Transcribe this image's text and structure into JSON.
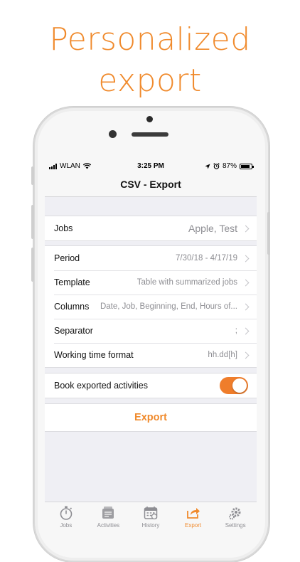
{
  "headline": {
    "line1": "Personalized",
    "line2": "export"
  },
  "status_bar": {
    "carrier": "WLAN",
    "time": "3:25 PM",
    "battery": "87%",
    "battery_level": 0.87
  },
  "nav": {
    "title": "CSV - Export"
  },
  "jobs_row": {
    "label": "Jobs",
    "value": "Apple, Test"
  },
  "settings_rows": [
    {
      "label": "Period",
      "value": "7/30/18 - 4/17/19"
    },
    {
      "label": "Template",
      "value": "Table with summarized jobs"
    },
    {
      "label": "Columns",
      "value": "Date, Job, Beginning, End, Hours of..."
    },
    {
      "label": "Separator",
      "value": ";"
    },
    {
      "label": "Working time format",
      "value": "hh.dd[h]"
    }
  ],
  "book_row": {
    "label": "Book exported activities",
    "toggle_on": true
  },
  "export_button": {
    "label": "Export"
  },
  "tabs": [
    {
      "label": "Jobs",
      "icon": "stopwatch-icon"
    },
    {
      "label": "Activities",
      "icon": "activities-icon"
    },
    {
      "label": "History",
      "icon": "calendar-icon"
    },
    {
      "label": "Export",
      "icon": "share-export-icon",
      "active": true
    },
    {
      "label": "Settings",
      "icon": "gear-icon"
    }
  ],
  "colors": {
    "accent": "#f08a2c",
    "toggle": "#ef7d2b"
  }
}
